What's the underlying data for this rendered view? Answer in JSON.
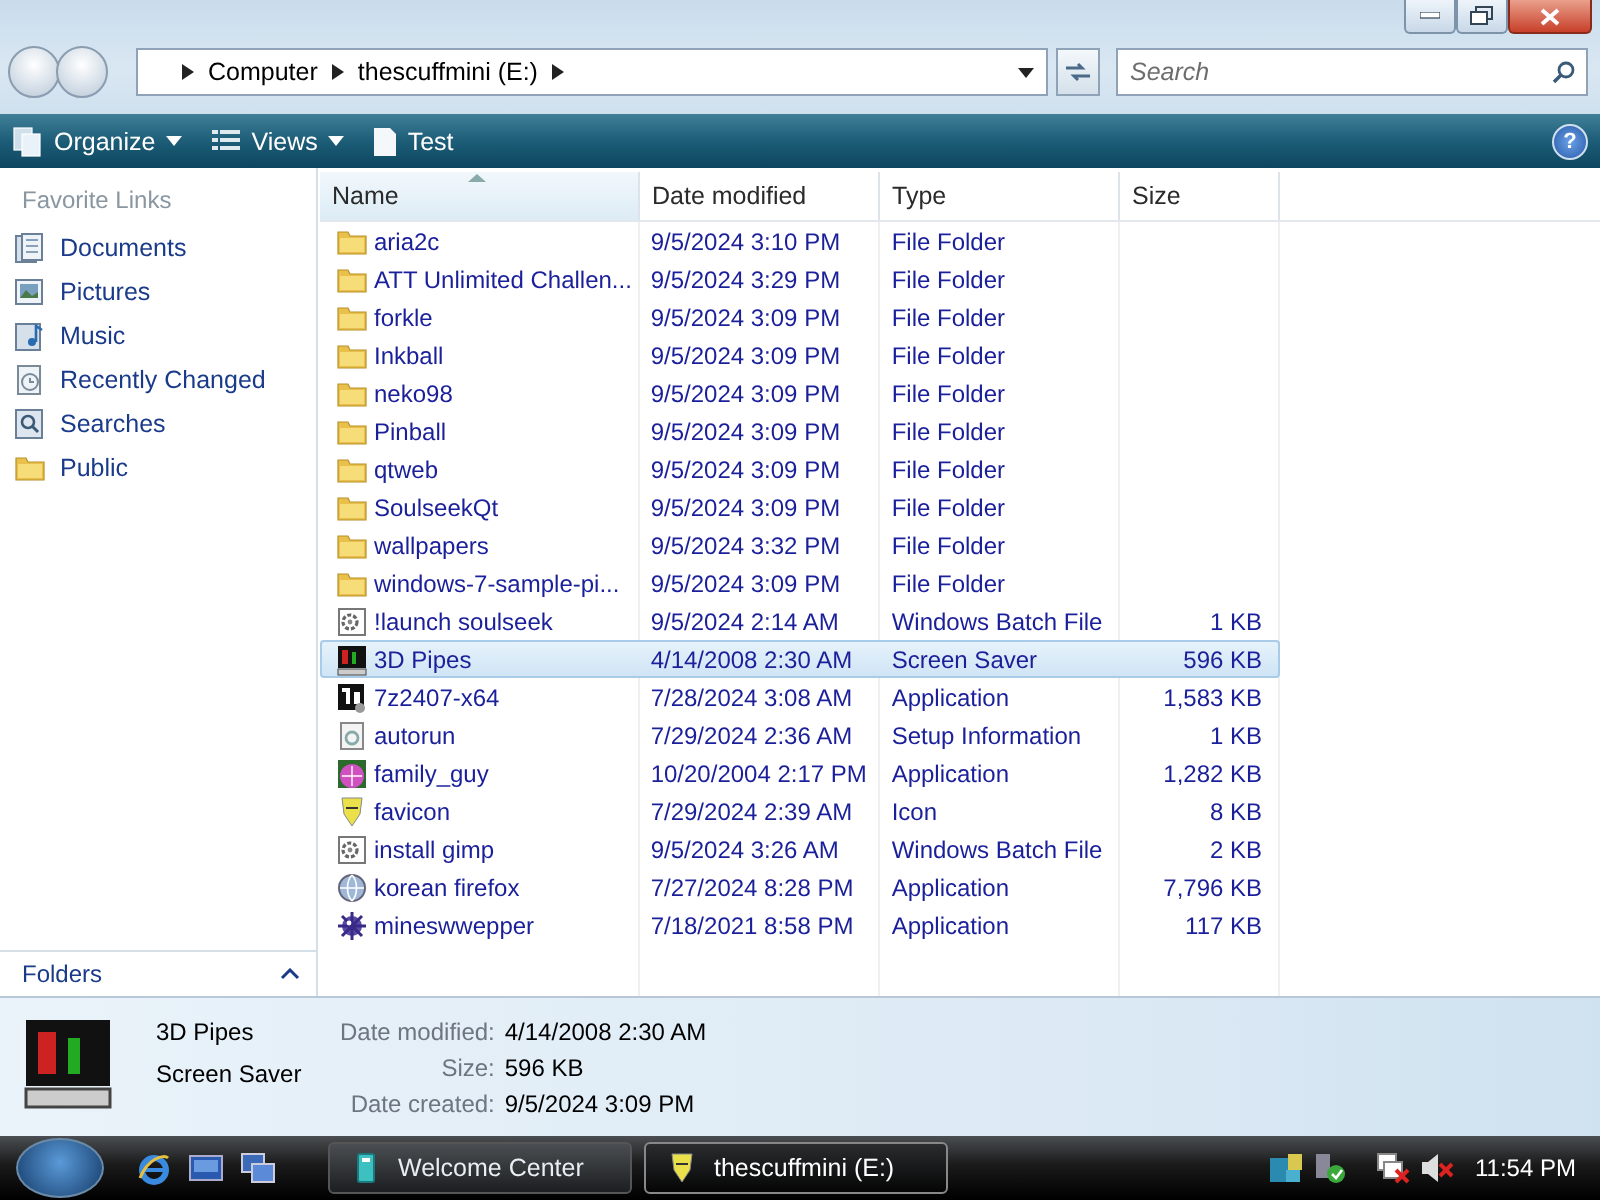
{
  "address": {
    "crumbs": [
      "Computer",
      "thescuffmini (E:)"
    ]
  },
  "search": {
    "placeholder": "Search"
  },
  "toolbar": {
    "buttons": [
      {
        "label": "Organize",
        "kind": "menu"
      },
      {
        "label": "Views",
        "kind": "menu"
      },
      {
        "label": "Test",
        "kind": "plain"
      }
    ],
    "help": "?"
  },
  "sidebar": {
    "title": "Favorite Links",
    "items": [
      {
        "label": "Documents",
        "kind": "documents"
      },
      {
        "label": "Pictures",
        "kind": "pictures"
      },
      {
        "label": "Music",
        "kind": "music"
      },
      {
        "label": "Recently Changed",
        "kind": "recent"
      },
      {
        "label": "Searches",
        "kind": "searches"
      },
      {
        "label": "Public",
        "kind": "folder"
      }
    ],
    "folders_label": "Folders"
  },
  "table": {
    "columns": [
      {
        "label": "Name",
        "sorted": true
      },
      {
        "label": "Date modified",
        "sorted": false
      },
      {
        "label": "Type",
        "sorted": false
      },
      {
        "label": "Size",
        "sorted": false
      }
    ],
    "rows": [
      {
        "name": "aria2c",
        "date": "9/5/2024 3:10 PM",
        "type": "File Folder",
        "kind": "folder",
        "selected": false
      },
      {
        "name": "ATT Unlimited Challen...",
        "date": "9/5/2024 3:29 PM",
        "type": "File Folder",
        "kind": "folder",
        "selected": false
      },
      {
        "name": "forkle",
        "date": "9/5/2024 3:09 PM",
        "type": "File Folder",
        "kind": "folder",
        "selected": false
      },
      {
        "name": "Inkball",
        "date": "9/5/2024 3:09 PM",
        "type": "File Folder",
        "kind": "folder",
        "selected": false
      },
      {
        "name": "neko98",
        "date": "9/5/2024 3:09 PM",
        "type": "File Folder",
        "kind": "folder",
        "selected": false
      },
      {
        "name": "Pinball",
        "date": "9/5/2024 3:09 PM",
        "type": "File Folder",
        "kind": "folder",
        "selected": false
      },
      {
        "name": "qtweb",
        "date": "9/5/2024 3:09 PM",
        "type": "File Folder",
        "kind": "folder",
        "selected": false
      },
      {
        "name": "SoulseekQt",
        "date": "9/5/2024 3:09 PM",
        "type": "File Folder",
        "kind": "folder",
        "selected": false
      },
      {
        "name": "wallpapers",
        "date": "9/5/2024 3:32 PM",
        "type": "File Folder",
        "kind": "folder",
        "selected": false
      },
      {
        "name": "windows-7-sample-pi...",
        "date": "9/5/2024 3:09 PM",
        "type": "File Folder",
        "kind": "folder",
        "selected": false
      },
      {
        "name": "!launch soulseek",
        "date": "9/5/2024 2:14 AM",
        "type": "Windows Batch File",
        "size": "1 KB",
        "kind": "batch",
        "selected": false
      },
      {
        "name": "3D Pipes",
        "date": "4/14/2008 2:30 AM",
        "type": "Screen Saver",
        "size": "596 KB",
        "kind": "screensaver",
        "selected": true
      },
      {
        "name": "7z2407-x64",
        "date": "7/28/2024 3:08 AM",
        "type": "Application",
        "size": "1,583 KB",
        "kind": "archive",
        "selected": false
      },
      {
        "name": "autorun",
        "date": "7/29/2024 2:36 AM",
        "type": "Setup Information",
        "size": "1 KB",
        "kind": "setup",
        "selected": false
      },
      {
        "name": "family_guy",
        "date": "10/20/2004 2:17 PM",
        "type": "Application",
        "size": "1,282 KB",
        "kind": "app",
        "selected": false
      },
      {
        "name": "favicon",
        "date": "7/29/2024 2:39 AM",
        "type": "Icon",
        "size": "8 KB",
        "kind": "icon",
        "selected": false
      },
      {
        "name": "install gimp",
        "date": "9/5/2024 3:26 AM",
        "type": "Windows Batch File",
        "size": "2 KB",
        "kind": "batch",
        "selected": false
      },
      {
        "name": "korean firefox",
        "date": "7/27/2024 8:28 PM",
        "type": "Application",
        "size": "7,796 KB",
        "kind": "globe",
        "selected": false
      },
      {
        "name": "mineswwepper",
        "date": "7/18/2021 8:58 PM",
        "type": "Application",
        "size": "117 KB",
        "kind": "mine",
        "selected": false
      }
    ]
  },
  "details": {
    "name": "3D Pipes",
    "type": "Screen Saver",
    "fields": [
      {
        "label": "Date modified:",
        "value": "4/14/2008 2:30 AM"
      },
      {
        "label": "Size:",
        "value": "596 KB"
      },
      {
        "label": "Date created:",
        "value": "9/5/2024 3:09 PM"
      }
    ]
  },
  "taskbar": {
    "buttons": [
      {
        "label": "Welcome Center",
        "kind": "welcome",
        "selected": false
      },
      {
        "label": "thescuffmini (E:)",
        "kind": "icon",
        "selected": true
      }
    ],
    "clock": "11:54 PM"
  }
}
